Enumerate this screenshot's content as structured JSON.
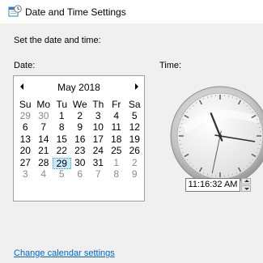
{
  "window": {
    "title": "Date and Time Settings",
    "icon": "calendar-clock-icon"
  },
  "instruction": "Set the date and time:",
  "date_label": "Date:",
  "time_label": "Time:",
  "calendar": {
    "month_title": "May 2018",
    "weekdays": [
      "Su",
      "Mo",
      "Tu",
      "We",
      "Th",
      "Fr",
      "Sa"
    ],
    "weeks": [
      [
        "29",
        "30",
        "1",
        "2",
        "3",
        "4",
        "5"
      ],
      [
        "6",
        "7",
        "8",
        "9",
        "10",
        "11",
        "12"
      ],
      [
        "13",
        "14",
        "15",
        "16",
        "17",
        "18",
        "19"
      ],
      [
        "20",
        "21",
        "22",
        "23",
        "24",
        "25",
        "26"
      ],
      [
        "27",
        "28",
        "29",
        "30",
        "31",
        "1",
        "2"
      ],
      [
        "3",
        "4",
        "5",
        "6",
        "7",
        "8",
        "9"
      ]
    ],
    "other_month_days": [
      [
        0,
        0
      ],
      [
        0,
        1
      ],
      [
        4,
        5
      ],
      [
        4,
        6
      ],
      [
        5,
        0
      ],
      [
        5,
        1
      ],
      [
        5,
        2
      ],
      [
        5,
        3
      ],
      [
        5,
        4
      ],
      [
        5,
        5
      ],
      [
        5,
        6
      ]
    ],
    "selected_day": "29"
  },
  "clock": {
    "hours": 11,
    "minutes": 16,
    "seconds": 32
  },
  "time_value": "11:16:32 AM",
  "change_calendar_link": "Change calendar settings",
  "colors": {
    "link": "#0066cc",
    "selection": "#cce8ff",
    "panel": "#f0f0f0"
  }
}
